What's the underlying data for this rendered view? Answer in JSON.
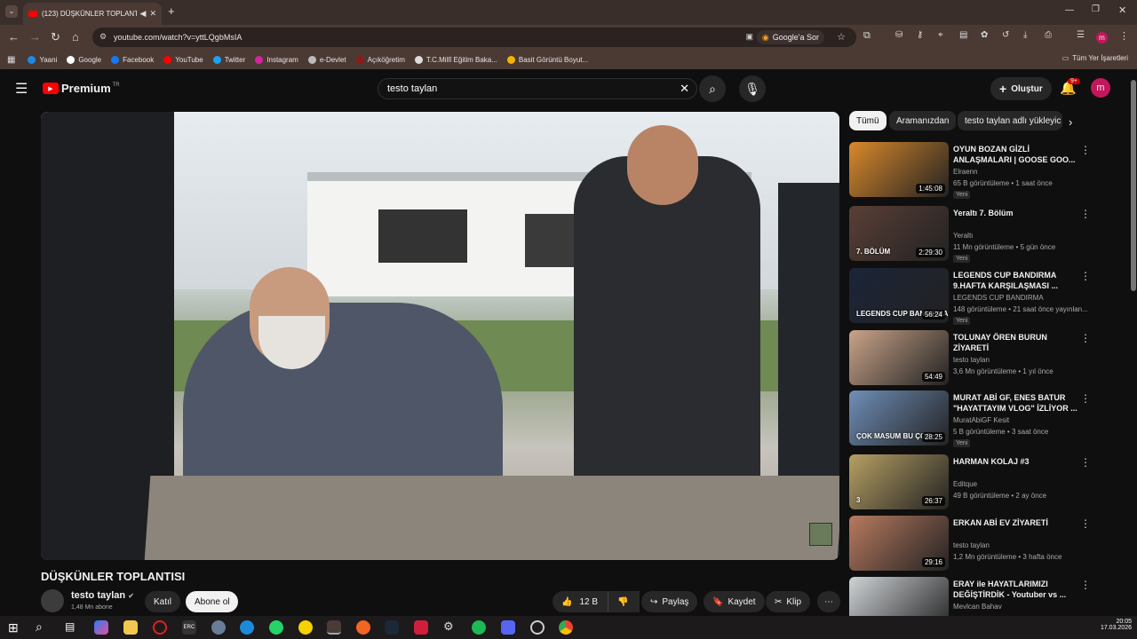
{
  "browser": {
    "tab_title": "(123) DÜŞKÜNLER TOPLANT",
    "url": "youtube.com/watch?v=yttLQgbMsIA",
    "ask_google": "Google'a Sor",
    "all_bookmarks": "Tüm Yer İşaretleri"
  },
  "bookmarks": [
    {
      "label": "Yaani",
      "color": "#1e88e5"
    },
    {
      "label": "Google",
      "color": "#ffffff"
    },
    {
      "label": "Facebook",
      "color": "#1877f2"
    },
    {
      "label": "YouTube",
      "color": "#ff0000"
    },
    {
      "label": "Twitter",
      "color": "#1da1f2"
    },
    {
      "label": "Instagram",
      "color": "#d6249f"
    },
    {
      "label": "e-Devlet",
      "color": "#bbbbbb"
    },
    {
      "label": "Açıköğretim",
      "color": "#8b1a1a"
    },
    {
      "label": "T.C.Millî Eğitim Baka...",
      "color": "#dddddd"
    },
    {
      "label": "Basit Görüntü Boyut...",
      "color": "#f4b400"
    }
  ],
  "youtube": {
    "logo": "Premium",
    "logo_sup": "TR",
    "search_value": "testo taylan",
    "create_label": "Oluştur",
    "notif_count": "9+",
    "avatar_letter": "m"
  },
  "video": {
    "title": "DÜŞKÜNLER TOPLANTISI",
    "channel": "testo taylan",
    "subs": "1,48 Mn abone",
    "join": "Katıl",
    "subscribe": "Abone ol",
    "likes": "12 B",
    "share": "Paylaş",
    "save": "Kaydet",
    "clip": "Klip"
  },
  "chips": [
    "Tümü",
    "Aramanızdan",
    "testo taylan adlı yükleyic"
  ],
  "recs": [
    {
      "title": "OYUN BOZAN GİZLİ ANLAŞMALARI | GOOSE GOO...",
      "channel": "Elraenn",
      "meta": "65 B görüntüleme • 1 saat önce",
      "duration": "1:45:08",
      "badge": "Yeni",
      "color": "#d9892b"
    },
    {
      "title": "Yeraltı 7. Bölüm",
      "channel": "Yeraltı",
      "meta": "11 Mn görüntüleme • 5 gün önce",
      "duration": "2:29:30",
      "badge": "Yeni",
      "color": "#5a3f36",
      "overlay": "7. BÖLÜM"
    },
    {
      "title": "LEGENDS CUP BANDIRMA 9.HAFTA KARŞILAŞMASI ...",
      "channel": "LEGENDS CUP BANDIRMA",
      "meta": "148 görüntüleme • 21 saat önce yayınlan...",
      "duration": "56:24",
      "badge": "Yeni",
      "color": "#1b2438",
      "overlay": "LEGENDS CUP BANDIRMA"
    },
    {
      "title": "TOLUNAY ÖREN BURUN ZİYARETİ",
      "channel": "testo taylan",
      "meta": "3,6 Mn görüntüleme • 1 yıl önce",
      "duration": "54:49",
      "color": "#c9a48a"
    },
    {
      "title": "MURAT ABİ GF, ENES BATUR \"HAYATTAYIM VLOG\" İZLİYOR ...",
      "channel": "MuratAbiGF Kesit",
      "meta": "5 B görüntüleme • 3 saat önce",
      "duration": "28:25",
      "badge": "Yeni",
      "color": "#6f8fb8",
      "overlay": "ÇOK MASUM BU ÇOC"
    },
    {
      "title": "HARMAN KOLAJ #3",
      "channel": "Editque",
      "meta": "49 B görüntüleme • 2 ay önce",
      "duration": "26:37",
      "color": "#b6a064",
      "overlay": "3"
    },
    {
      "title": "ERKAN ABİ EV ZİYARETİ",
      "channel": "testo taylan",
      "meta": "1,2 Mn görüntüleme • 3 hafta önce",
      "duration": "29:16",
      "color": "#b87a5f"
    },
    {
      "title": "ERAY ile HAYATLARIMIZI DEĞİŞTİRDİK - Youtuber vs ...",
      "channel": "Mevlcan Bahav",
      "meta": "",
      "duration": "",
      "color": "#cfd3d6"
    }
  ],
  "taskbar": {
    "time": "20:05",
    "date": "17.03.2026"
  }
}
